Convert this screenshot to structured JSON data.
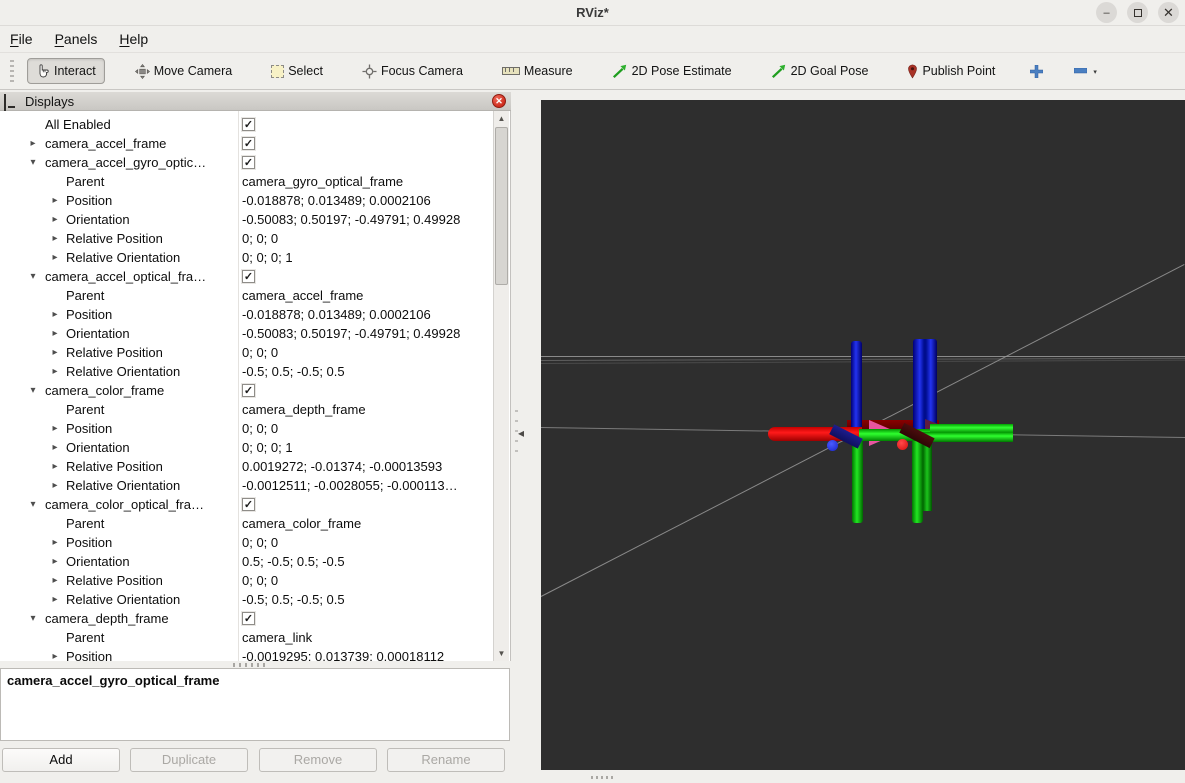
{
  "window": {
    "title": "RViz*",
    "controls": {
      "minimize": "minimize",
      "maximize": "maximize",
      "close": "close"
    }
  },
  "menu": {
    "items": [
      {
        "mnemonic": "F",
        "rest": "ile"
      },
      {
        "mnemonic": "P",
        "rest": "anels"
      },
      {
        "mnemonic": "H",
        "rest": "elp"
      }
    ]
  },
  "toolbar": {
    "tools": [
      {
        "label": "Interact",
        "icon": "interact-hand",
        "active": true
      },
      {
        "label": "Move Camera",
        "icon": "move-camera",
        "active": false
      },
      {
        "label": "Select",
        "icon": "select-box",
        "active": false
      },
      {
        "label": "Focus Camera",
        "icon": "focus-crosshair",
        "active": false
      },
      {
        "label": "Measure",
        "icon": "ruler",
        "active": false
      },
      {
        "label": "2D Pose Estimate",
        "icon": "green-arrow",
        "active": false
      },
      {
        "label": "2D Goal Pose",
        "icon": "green-arrow",
        "active": false
      },
      {
        "label": "Publish Point",
        "icon": "map-pin",
        "active": false
      },
      {
        "label": "",
        "icon": "add-tool-plus",
        "active": false
      },
      {
        "label": "",
        "icon": "remove-tool-minus",
        "active": false,
        "dropdown": true
      }
    ]
  },
  "displays_panel": {
    "title": "Displays",
    "rows": [
      {
        "name": "All Enabled",
        "level": 1,
        "expand": null,
        "checked": true
      },
      {
        "name": "camera_accel_frame",
        "level": 1,
        "expand": "closed",
        "checked": true
      },
      {
        "name": "camera_accel_gyro_optic…",
        "level": 1,
        "expand": "open",
        "checked": true
      },
      {
        "name": "Parent",
        "level": 2,
        "expand": null,
        "value": "camera_gyro_optical_frame"
      },
      {
        "name": "Position",
        "level": 2,
        "expand": "closed",
        "value": "-0.018878; 0.013489; 0.0002106"
      },
      {
        "name": "Orientation",
        "level": 2,
        "expand": "closed",
        "value": "-0.50083; 0.50197; -0.49791; 0.49928"
      },
      {
        "name": "Relative Position",
        "level": 2,
        "expand": "closed",
        "value": "0; 0; 0"
      },
      {
        "name": "Relative Orientation",
        "level": 2,
        "expand": "closed",
        "value": "0; 0; 0; 1"
      },
      {
        "name": "camera_accel_optical_fra…",
        "level": 1,
        "expand": "open",
        "checked": true
      },
      {
        "name": "Parent",
        "level": 2,
        "expand": null,
        "value": "camera_accel_frame"
      },
      {
        "name": "Position",
        "level": 2,
        "expand": "closed",
        "value": "-0.018878; 0.013489; 0.0002106"
      },
      {
        "name": "Orientation",
        "level": 2,
        "expand": "closed",
        "value": "-0.50083; 0.50197; -0.49791; 0.49928"
      },
      {
        "name": "Relative Position",
        "level": 2,
        "expand": "closed",
        "value": "0; 0; 0"
      },
      {
        "name": "Relative Orientation",
        "level": 2,
        "expand": "closed",
        "value": "-0.5; 0.5; -0.5; 0.5"
      },
      {
        "name": "camera_color_frame",
        "level": 1,
        "expand": "open",
        "checked": true
      },
      {
        "name": "Parent",
        "level": 2,
        "expand": null,
        "value": "camera_depth_frame"
      },
      {
        "name": "Position",
        "level": 2,
        "expand": "closed",
        "value": "0; 0; 0"
      },
      {
        "name": "Orientation",
        "level": 2,
        "expand": "closed",
        "value": "0; 0; 0; 1"
      },
      {
        "name": "Relative Position",
        "level": 2,
        "expand": "closed",
        "value": "0.0019272; -0.01374; -0.00013593"
      },
      {
        "name": "Relative Orientation",
        "level": 2,
        "expand": "closed",
        "value": "-0.0012511; -0.0028055; -0.000113…"
      },
      {
        "name": "camera_color_optical_fra…",
        "level": 1,
        "expand": "open",
        "checked": true
      },
      {
        "name": "Parent",
        "level": 2,
        "expand": null,
        "value": "camera_color_frame"
      },
      {
        "name": "Position",
        "level": 2,
        "expand": "closed",
        "value": "0; 0; 0"
      },
      {
        "name": "Orientation",
        "level": 2,
        "expand": "closed",
        "value": "0.5; -0.5; 0.5; -0.5"
      },
      {
        "name": "Relative Position",
        "level": 2,
        "expand": "closed",
        "value": "0; 0; 0"
      },
      {
        "name": "Relative Orientation",
        "level": 2,
        "expand": "closed",
        "value": "-0.5; 0.5; -0.5; 0.5"
      },
      {
        "name": "camera_depth_frame",
        "level": 1,
        "expand": "open",
        "checked": true
      },
      {
        "name": "Parent",
        "level": 2,
        "expand": null,
        "value": "camera_link"
      },
      {
        "name": "Position",
        "level": 2,
        "expand": "closed",
        "value": "-0.0019295; 0.013739; 0.00018112"
      }
    ],
    "selected_help": "camera_accel_gyro_optical_frame",
    "buttons": [
      {
        "label": "Add",
        "enabled": true
      },
      {
        "label": "Duplicate",
        "enabled": false
      },
      {
        "label": "Remove",
        "enabled": false
      },
      {
        "label": "Rename",
        "enabled": false
      }
    ]
  },
  "viewport": {
    "background": "#2e2e2e",
    "axis_colors": {
      "x": "#e00000",
      "y": "#19d419",
      "z": "#1a2ce0"
    },
    "arrow_color": "#e8559f",
    "grid_color": "#9b9b9b"
  },
  "colors": {
    "accent_blue": "#4a7fc1",
    "close_red": "#cf2d1e",
    "tool_green": "#2db02d"
  }
}
